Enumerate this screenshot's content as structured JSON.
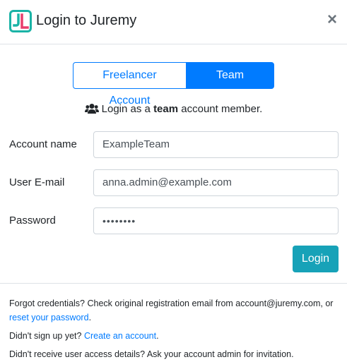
{
  "header": {
    "title": "Login to Juremy",
    "close_label": "×"
  },
  "account_toggle": {
    "freelancer_label": "Freelancer Account",
    "team_label": "Team Account",
    "selected": "team"
  },
  "info": {
    "prefix": "Login as a",
    "bold": "team",
    "suffix": "account member."
  },
  "form": {
    "account_name": {
      "label": "Account name",
      "value": "ExampleTeam"
    },
    "email": {
      "label": "User E-mail",
      "value": "anna.admin@example.com"
    },
    "password": {
      "label": "Password",
      "value": "••••••••"
    },
    "login_label": "Login"
  },
  "footer": {
    "forgot_text": "Forgot credentials? Check original registration email from account@juremy.com, or",
    "reset_link": "reset your password",
    "period1": ".",
    "signup_text": "Didn't sign up yet?",
    "signup_link": "Create an account",
    "period2": ".",
    "access_text": "Didn't receive user access details? Ask your account admin for invitation."
  },
  "colors": {
    "brand": "#1ab3a6",
    "primary": "#007bff",
    "login_button": "#17a2b8"
  }
}
